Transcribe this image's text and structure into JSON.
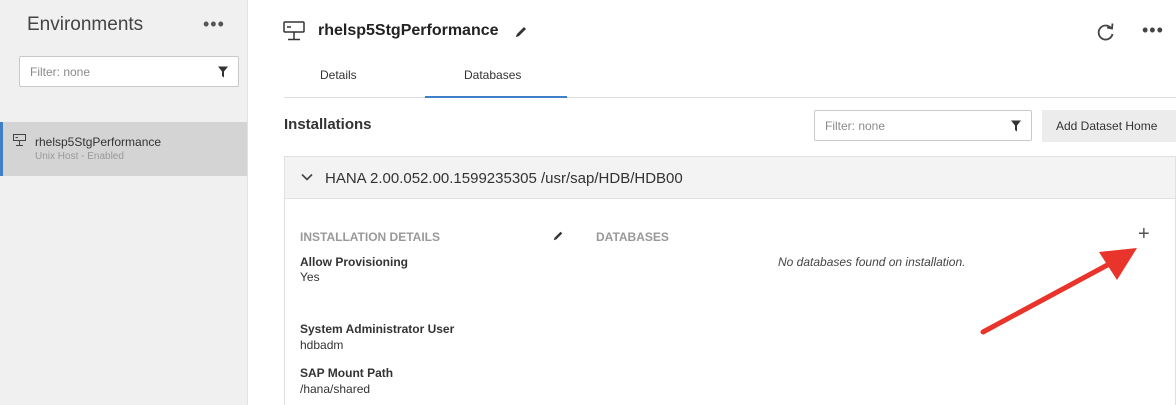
{
  "sidebar": {
    "title": "Environments",
    "more_glyph": "•••",
    "filter_placeholder": "Filter: none",
    "environment": {
      "name": "rhelsp5StgPerformance",
      "subtitle": "Unix Host - Enabled"
    }
  },
  "header": {
    "title": "rhelsp5StgPerformance",
    "more_glyph": "•••"
  },
  "tabs": [
    {
      "label": "Details",
      "active": false
    },
    {
      "label": "Databases",
      "active": true
    }
  ],
  "installations": {
    "title": "Installations",
    "filter_placeholder": "Filter: none",
    "add_button_label": "Add Dataset Home",
    "item": {
      "title": "HANA 2.00.052.00.1599235305 /usr/sap/HDB/HDB00",
      "details_label": "INSTALLATION DETAILS",
      "databases_label": "DATABASES",
      "add_glyph": "+",
      "empty_message": "No databases found on installation.",
      "fields": [
        {
          "label": "Allow Provisioning",
          "value": "Yes"
        },
        {
          "label": "System Administrator User",
          "value": "hdbadm"
        },
        {
          "label": "SAP Mount Path",
          "value": "/hana/shared"
        }
      ]
    }
  },
  "colors": {
    "accent": "#3f7fc6",
    "annotation_arrow": "#e8342a"
  }
}
